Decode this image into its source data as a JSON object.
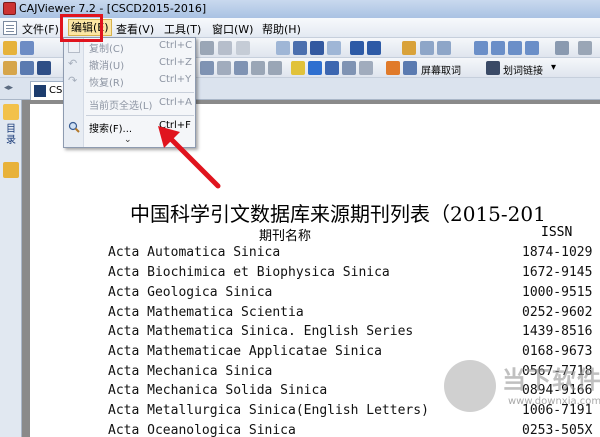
{
  "window": {
    "title": "CAJViewer 7.2 - [CSCD2015-2016]"
  },
  "menubar": {
    "items": [
      "文件(F)",
      "编辑(E)",
      "查看(V)",
      "工具(T)",
      "窗口(W)",
      "帮助(H)"
    ]
  },
  "toolbar2": {
    "screen_word_label": "屏幕取词",
    "link_label": "划词链接"
  },
  "tab": {
    "label": "CSC"
  },
  "sidebar": {
    "label1": "目录",
    "label2": ""
  },
  "edit_menu": {
    "items": [
      {
        "label": "复制(C)",
        "shortcut": "Ctrl+C"
      },
      {
        "label": "撤消(U)",
        "shortcut": "Ctrl+Z"
      },
      {
        "label": "恢复(R)",
        "shortcut": "Ctrl+Y"
      },
      {
        "label": "当前页全选(L)",
        "shortcut": "Ctrl+A"
      },
      {
        "label": "搜索(F)...",
        "shortcut": "Ctrl+F"
      }
    ],
    "more": "⌄"
  },
  "document": {
    "title": "中国科学引文数据库来源期刊列表（2015-201",
    "col_name": "期刊名称",
    "col_issn": "ISSN",
    "rows": [
      {
        "name": "Acta Automatica Sinica",
        "issn": "1874-1029"
      },
      {
        "name": "Acta Biochimica et Biophysica Sinica",
        "issn": "1672-9145"
      },
      {
        "name": "Acta Geologica Sinica",
        "issn": "1000-9515"
      },
      {
        "name": "Acta Mathematica Scientia",
        "issn": "0252-9602"
      },
      {
        "name": "Acta Mathematica Sinica. English Series",
        "issn": "1439-8516"
      },
      {
        "name": "Acta Mathematicae Applicatae Sinica",
        "issn": "0168-9673"
      },
      {
        "name": "Acta Mechanica Sinica",
        "issn": "0567-7718"
      },
      {
        "name": "Acta Mechanica Solida Sinica",
        "issn": "0894-9166"
      },
      {
        "name": "Acta Metallurgica Sinica(English Letters)",
        "issn": "1006-7191"
      },
      {
        "name": "Acta Oceanologica Sinica",
        "issn": "0253-505X"
      }
    ]
  },
  "watermark": {
    "text": "当下软件园",
    "url": "www.downxia.com"
  },
  "colors": {
    "highlight": "#e0141e",
    "menu_bg": "#f4f6f9"
  }
}
